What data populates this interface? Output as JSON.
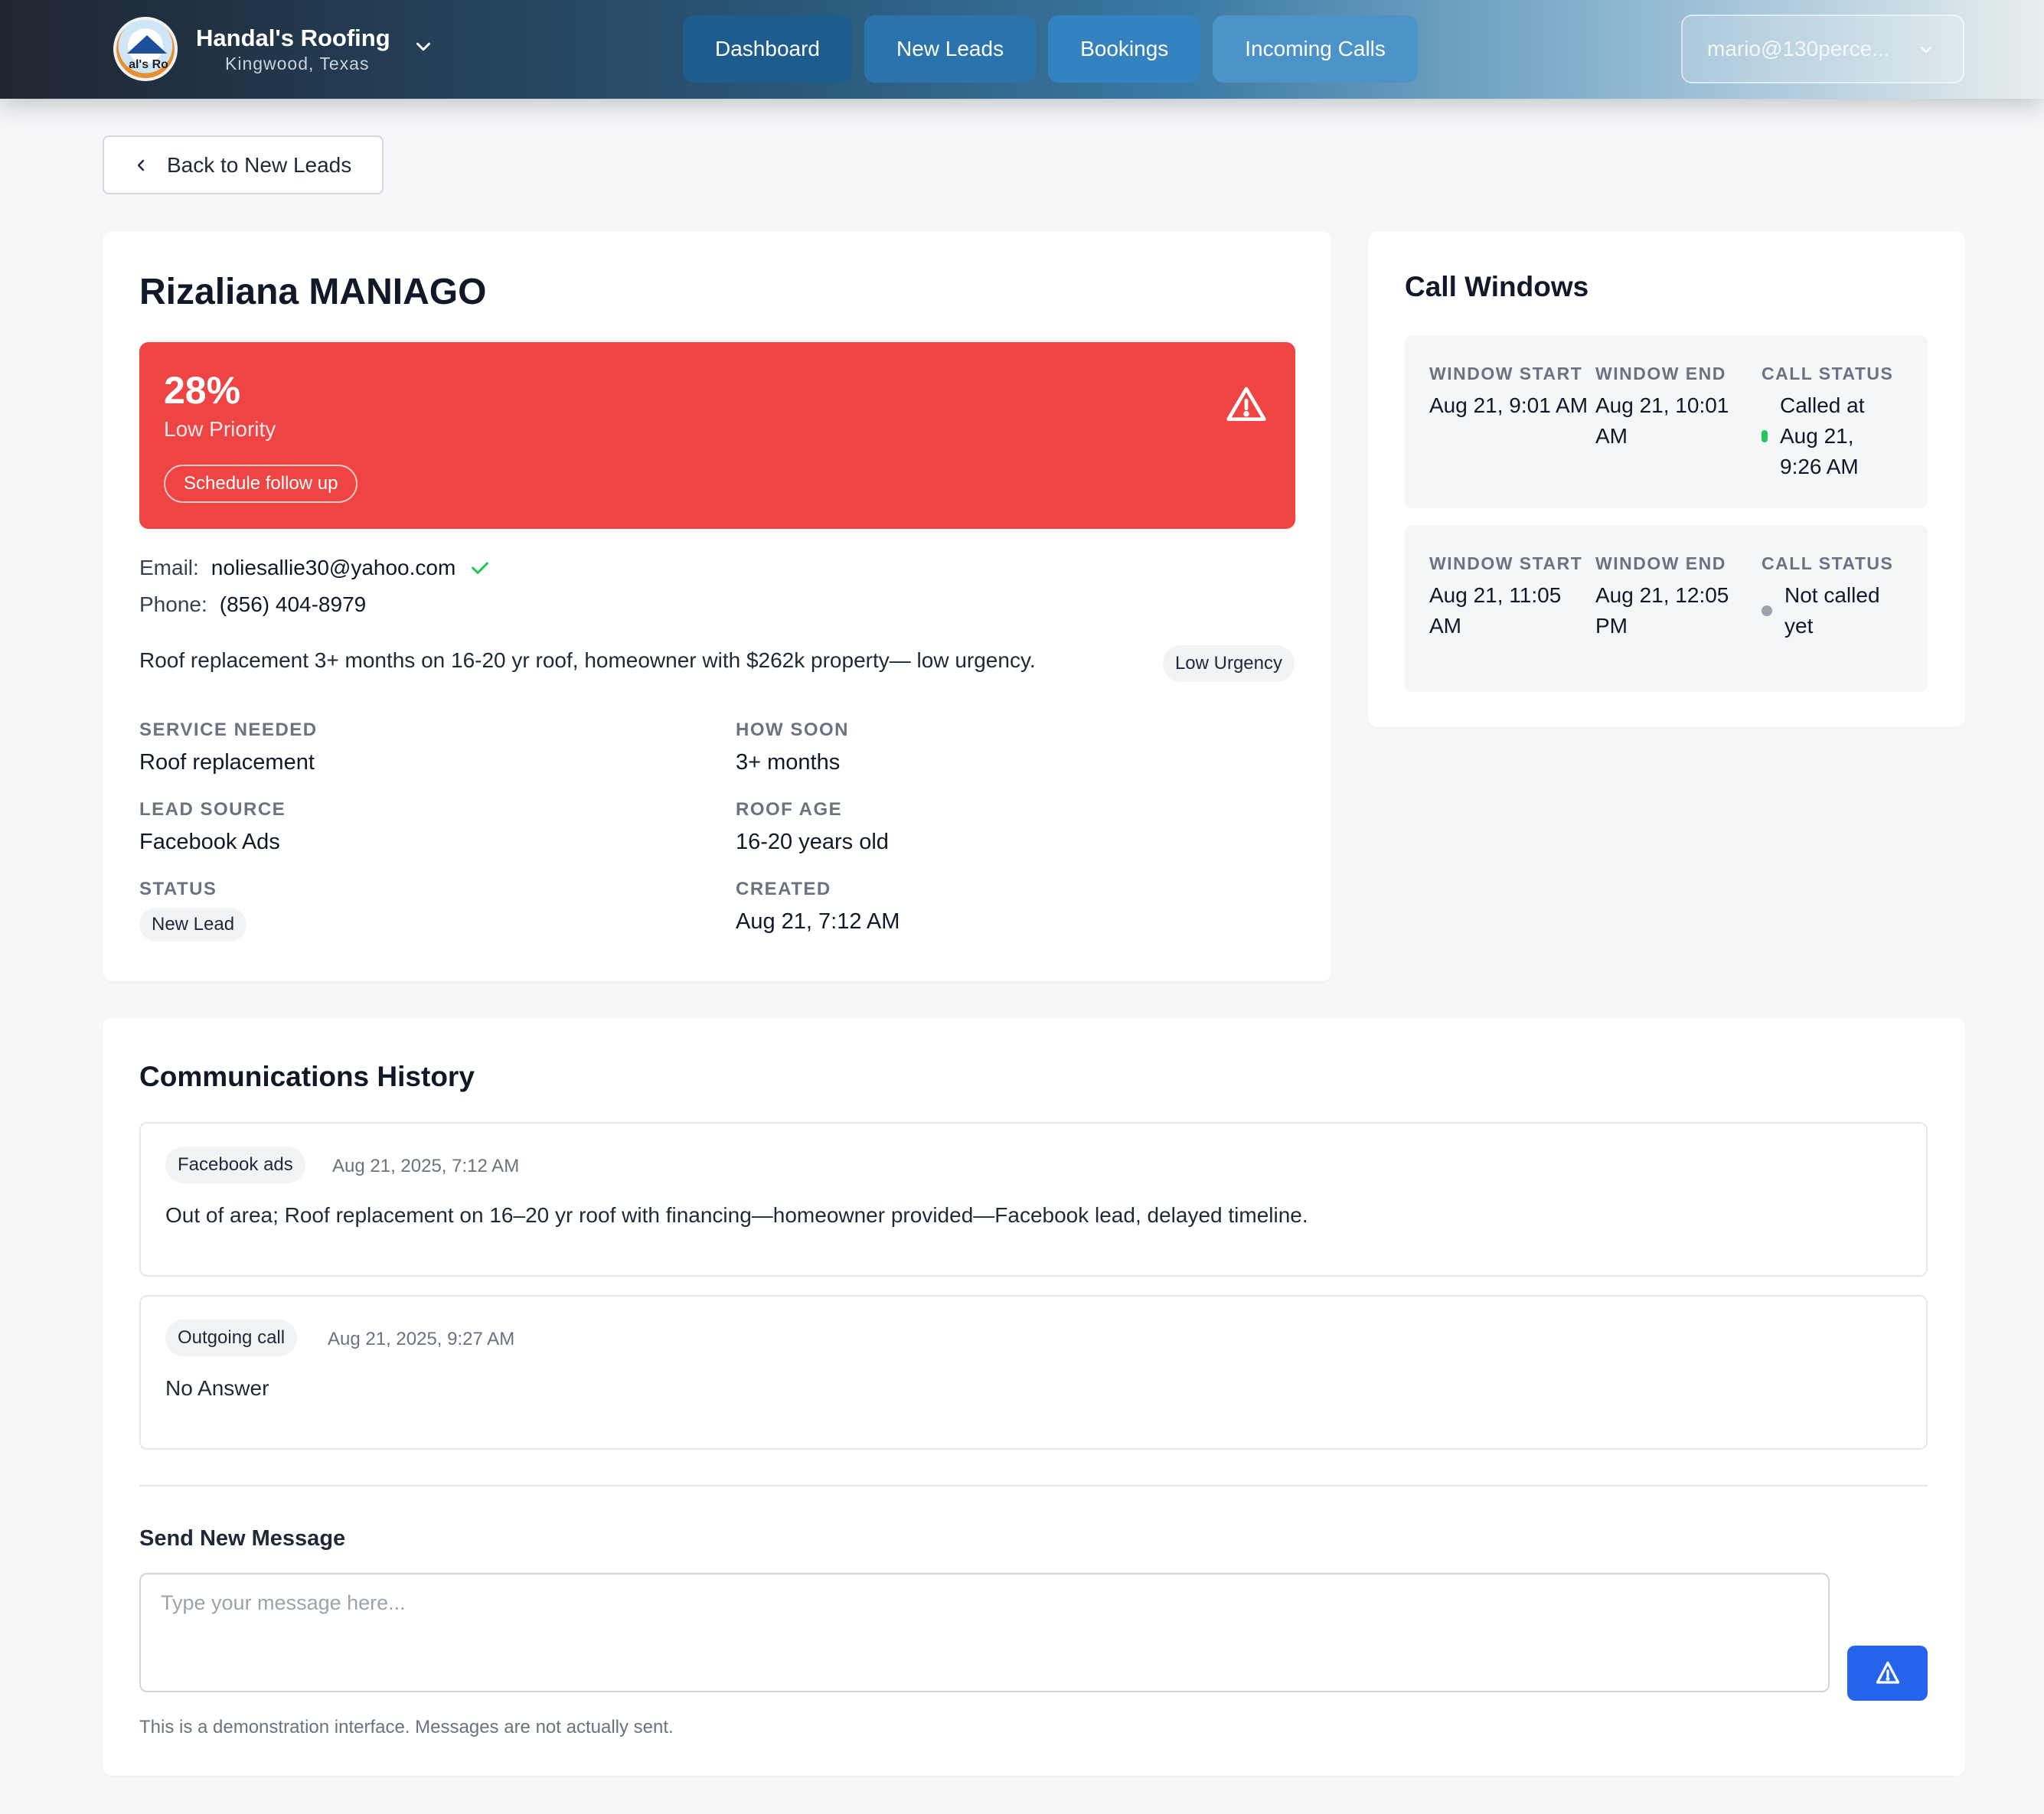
{
  "header": {
    "brand_name": "Handal's Roofing",
    "brand_location": "Kingwood, Texas",
    "logo_text": "al's Ro",
    "nav": [
      "Dashboard",
      "New Leads",
      "Bookings",
      "Incoming Calls"
    ],
    "user_email": "mario@130perce..."
  },
  "back_label": "Back to New Leads",
  "lead": {
    "name": "Rizaliana MANIAGO",
    "score": "28%",
    "priority_label": "Low Priority",
    "follow_up_label": "Schedule follow up",
    "email_label": "Email:",
    "email": "noliesallie30@yahoo.com",
    "phone_label": "Phone:",
    "phone": "(856) 404-8979",
    "summary": "Roof replacement 3+ months on 16-20 yr roof, homeowner with $262k property— low urgency.",
    "urgency": "Low Urgency",
    "fields": {
      "service_label": "SERVICE NEEDED",
      "service": "Roof replacement",
      "how_soon_label": "HOW SOON",
      "how_soon": "3+ months",
      "source_label": "LEAD SOURCE",
      "source": "Facebook Ads",
      "roof_age_label": "ROOF AGE",
      "roof_age": "16-20 years old",
      "status_label": "STATUS",
      "status": "New Lead",
      "created_label": "CREATED",
      "created": "Aug 21, 7:12 AM"
    },
    "colors": {
      "priority_bg": "#ef4444",
      "verified": "#22c55e"
    }
  },
  "call_windows": {
    "title": "Call Windows",
    "labels": {
      "start": "WINDOW START",
      "end": "WINDOW END",
      "status": "CALL STATUS"
    },
    "windows": [
      {
        "start": "Aug 21, 9:01 AM",
        "end": "Aug 21, 10:01 AM",
        "status": "Called at Aug 21, 9:26 AM",
        "status_color": "#22c55e"
      },
      {
        "start": "Aug 21, 11:05 AM",
        "end": "Aug 21, 12:05 PM",
        "status": "Not called yet",
        "status_color": "#9ca3af"
      }
    ]
  },
  "communications": {
    "title": "Communications History",
    "messages": [
      {
        "channel": "Facebook ads",
        "time": "Aug 21, 2025, 7:12 AM",
        "body": "Out of area; Roof replacement on 16–20 yr roof with financing—homeowner provided—Facebook lead, delayed timeline."
      },
      {
        "channel": "Outgoing call",
        "time": "Aug 21, 2025, 9:27 AM",
        "body": "No Answer"
      }
    ],
    "send_title": "Send New Message",
    "placeholder": "Type your message here...",
    "note": "This is a demonstration interface. Messages are not actually sent.",
    "send_color": "#2563eb"
  }
}
